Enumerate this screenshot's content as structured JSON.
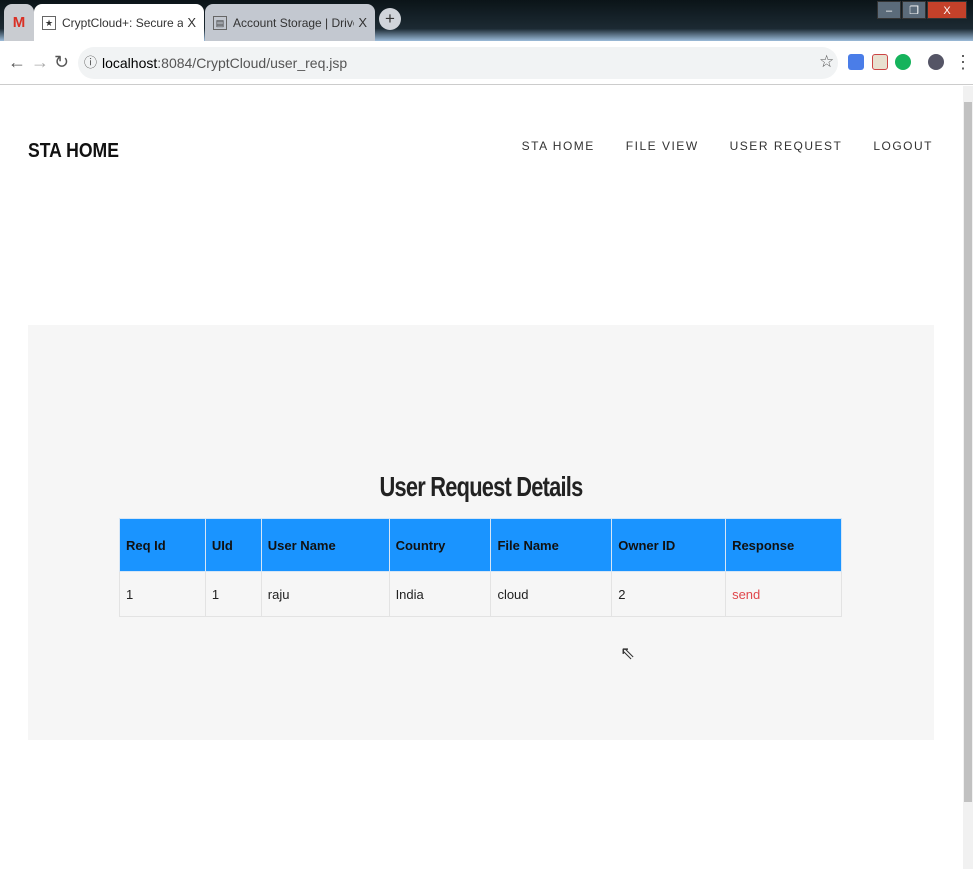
{
  "browser": {
    "tabs": [
      {
        "label": "M",
        "icon": "gmail-icon"
      },
      {
        "label": "CryptCloud+: Secure and Expres",
        "close": "X"
      },
      {
        "label": "Account Storage | DriveHQ",
        "close": "X"
      }
    ],
    "new_tab": "+",
    "url_host": "localhost",
    "url_path": ":8084/CryptCloud/user_req.jsp",
    "window_controls": [
      "‒",
      "❐",
      "X"
    ]
  },
  "header": {
    "logo": "STA HOME",
    "nav": [
      "STA HOME",
      "FILE VIEW",
      "USER REQUEST",
      "LOGOUT"
    ]
  },
  "main": {
    "title": "User Request Details",
    "columns": [
      "Req Id",
      "UId",
      "User Name",
      "Country",
      "File Name",
      "Owner ID",
      "Response"
    ],
    "rows": [
      [
        "1",
        "1",
        "raju",
        "India",
        "cloud",
        "2",
        "send"
      ]
    ]
  },
  "colors": {
    "table_header": "#1a94ff",
    "link": "#e0474c",
    "panel": "#f6f6f6"
  }
}
